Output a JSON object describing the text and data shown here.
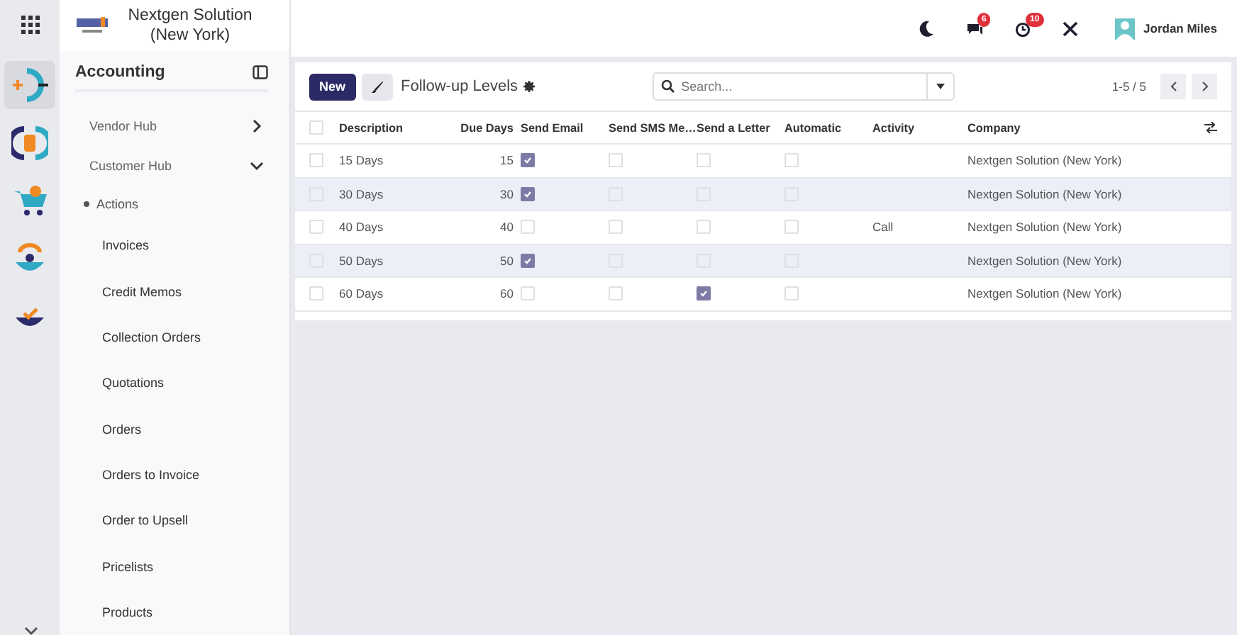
{
  "rail": {
    "apps": [
      {
        "selected": true
      },
      {
        "selected": false
      },
      {
        "selected": false
      },
      {
        "selected": false
      },
      {
        "selected": false
      }
    ]
  },
  "company": {
    "name": "Nextgen Solution (New York)"
  },
  "sidebar": {
    "title": "Accounting",
    "items": [
      {
        "label": "Vendor Hub",
        "expanded": false
      },
      {
        "label": "Customer Hub",
        "expanded": true,
        "children": [
          {
            "label": "Actions",
            "children": [
              {
                "label": "Invoices"
              },
              {
                "label": "Credit Memos"
              },
              {
                "label": "Collection Orders"
              },
              {
                "label": "Quotations"
              },
              {
                "label": "Orders"
              },
              {
                "label": "Orders to Invoice"
              },
              {
                "label": "Order to Upsell"
              },
              {
                "label": "Pricelists"
              },
              {
                "label": "Products"
              }
            ]
          }
        ]
      }
    ]
  },
  "topbar": {
    "messages_badge": "6",
    "activities_badge": "10",
    "user": "Jordan Miles"
  },
  "toolbar": {
    "new_button": "New",
    "title": "Follow-up Levels",
    "search": {
      "placeholder": "Search..."
    },
    "pager": "1-5 / 5"
  },
  "table": {
    "all_selected": false,
    "columns": [
      "Description",
      "Due Days",
      "Send Email",
      "Send SMS Me…",
      "Send a Letter",
      "Automatic",
      "Activity",
      "Company"
    ],
    "rows": [
      {
        "selected": false,
        "description": "15 Days",
        "due_days": "15",
        "send_email": true,
        "send_sms": false,
        "send_letter": false,
        "automatic": false,
        "activity": "",
        "company": "Nextgen Solution (New York)"
      },
      {
        "selected": false,
        "description": "30 Days",
        "due_days": "30",
        "send_email": true,
        "send_sms": false,
        "send_letter": false,
        "automatic": false,
        "activity": "",
        "company": "Nextgen Solution (New York)"
      },
      {
        "selected": false,
        "description": "40 Days",
        "due_days": "40",
        "send_email": false,
        "send_sms": false,
        "send_letter": false,
        "automatic": false,
        "activity": "Call",
        "company": "Nextgen Solution (New York)"
      },
      {
        "selected": false,
        "description": "50 Days",
        "due_days": "50",
        "send_email": true,
        "send_sms": false,
        "send_letter": false,
        "automatic": false,
        "activity": "",
        "company": "Nextgen Solution (New York)"
      },
      {
        "selected": false,
        "description": "60 Days",
        "due_days": "60",
        "send_email": false,
        "send_sms": false,
        "send_letter": true,
        "automatic": false,
        "activity": "",
        "company": "Nextgen Solution (New York)"
      }
    ]
  }
}
